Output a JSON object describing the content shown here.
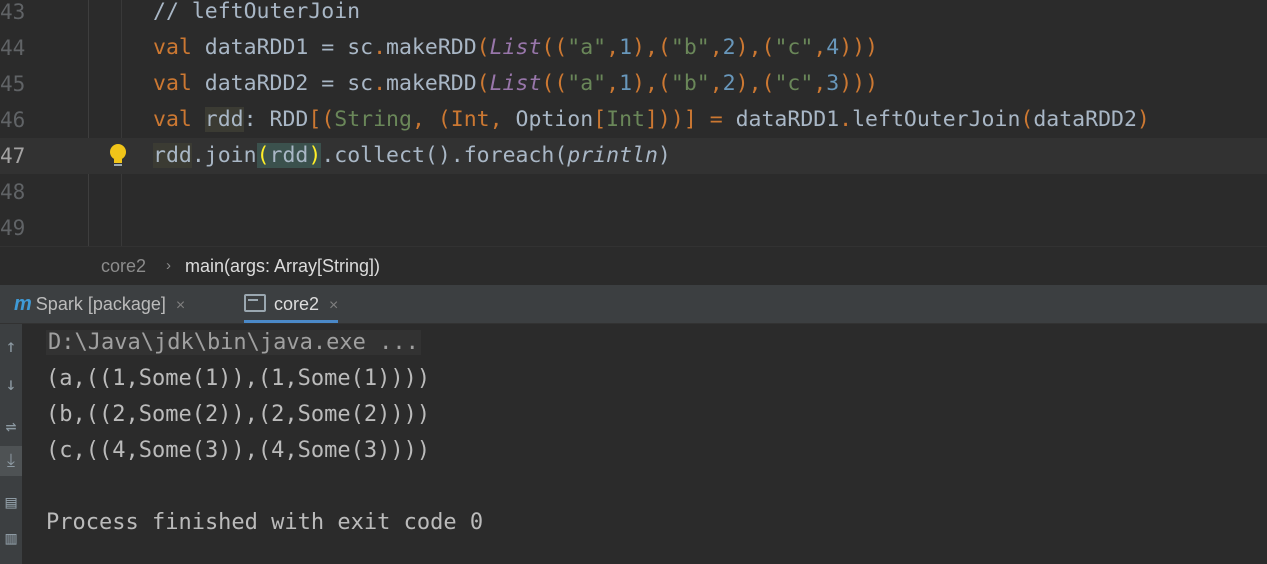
{
  "editor": {
    "lines": [
      {
        "num": "43",
        "code": "// leftOuterJoin"
      },
      {
        "num": "44",
        "code": "val dataRDD1 = sc.makeRDD(List((\"a\",1),(\"b\",2),(\"c\",4)))"
      },
      {
        "num": "45",
        "code": "val dataRDD2 = sc.makeRDD(List((\"a\",1),(\"b\",2),(\"c\",3)))"
      },
      {
        "num": "46",
        "code": "val rdd: RDD[(String, (Int, Option[Int]))] = dataRDD1.leftOuterJoin(dataRDD2)"
      },
      {
        "num": "47",
        "code": "rdd.join(rdd).collect().foreach(println)"
      },
      {
        "num": "48",
        "code": ""
      },
      {
        "num": "49",
        "code": ""
      }
    ],
    "current_line": "47",
    "intention_icon": "lightbulb-icon"
  },
  "breadcrumb": {
    "items": [
      "core2",
      "main(args: Array[String])"
    ],
    "separator": "›"
  },
  "run_panel": {
    "tabs": [
      {
        "label": "Spark [package]",
        "icon": "maven-icon",
        "close": "×"
      },
      {
        "label": "core2",
        "icon": "console-icon",
        "close": "×",
        "active": true
      }
    ],
    "toolbar": [
      "up-arrow-icon",
      "down-arrow-icon",
      "soft-wrap-icon",
      "scroll-to-end-icon",
      "print-icon",
      "clear-all-icon"
    ],
    "output": [
      "D:\\Java\\jdk\\bin\\java.exe ...",
      "(a,((1,Some(1)),(1,Some(1))))",
      "(b,((2,Some(2)),(2,Some(2))))",
      "(c,((4,Some(3)),(4,Some(3))))",
      "",
      "Process finished with exit code 0"
    ]
  },
  "colors": {
    "keyword": "#cc7832",
    "string": "#6a8759",
    "number": "#6897bb",
    "comment": "#808080",
    "accent": "#4a88c7"
  }
}
